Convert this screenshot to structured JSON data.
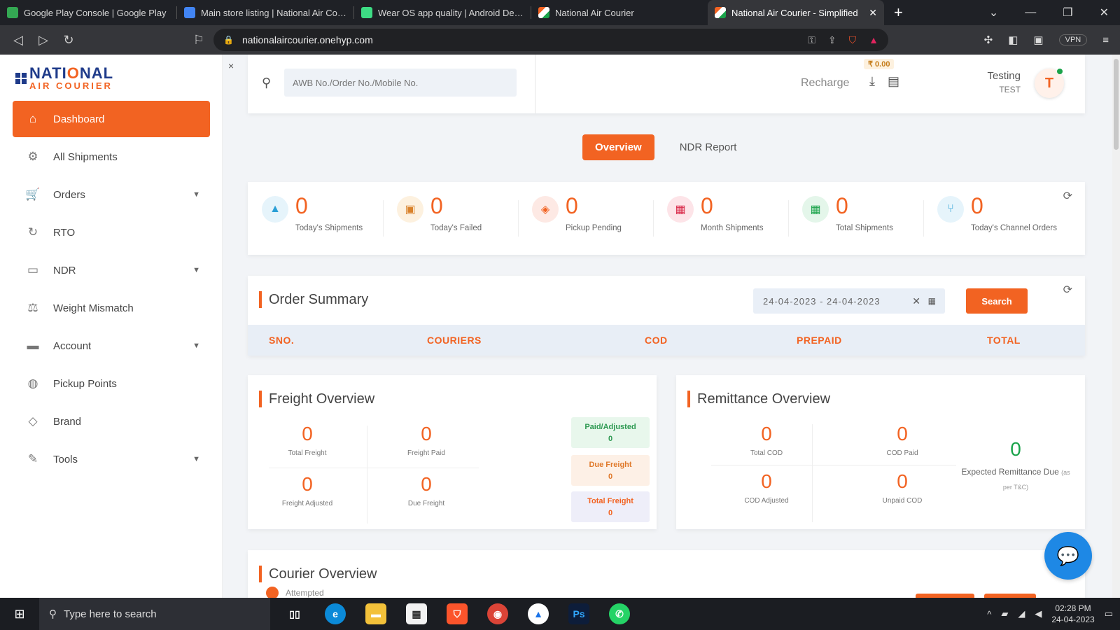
{
  "browser": {
    "tabs": [
      {
        "title": "Google Play Console | Google Play",
        "color": "#34a853"
      },
      {
        "title": "Main store listing | National Air Courier",
        "color": "#4285f4"
      },
      {
        "title": "Wear OS app quality | Android Developers",
        "color": "#3ddc84"
      },
      {
        "title": "National Air Courier",
        "color": "#f26322"
      },
      {
        "title": "National Air Courier - Simplified",
        "color": "#f26322"
      }
    ],
    "url": "nationalaircourier.onehyp.com",
    "vpn_label": "VPN"
  },
  "sidebar": {
    "logo_line1_a": "NATI",
    "logo_line1_b": "O",
    "logo_line1_c": "NAL",
    "logo_line2": "AIR COURIER",
    "close": "×",
    "items": [
      {
        "label": "Dashboard",
        "icon": "home-icon",
        "glyph": "⌂",
        "active": true,
        "chevron": false
      },
      {
        "label": "All Shipments",
        "icon": "shipments-icon",
        "glyph": "⚙",
        "active": false,
        "chevron": false
      },
      {
        "label": "Orders",
        "icon": "cart-icon",
        "glyph": "🛒",
        "active": false,
        "chevron": true
      },
      {
        "label": "RTO",
        "icon": "return-icon",
        "glyph": "↻",
        "active": false,
        "chevron": false
      },
      {
        "label": "NDR",
        "icon": "message-icon",
        "glyph": "▭",
        "active": false,
        "chevron": true
      },
      {
        "label": "Weight Mismatch",
        "icon": "weight-icon",
        "glyph": "⚖",
        "active": false,
        "chevron": false
      },
      {
        "label": "Account",
        "icon": "wallet-icon",
        "glyph": "▬",
        "active": false,
        "chevron": true
      },
      {
        "label": "Pickup Points",
        "icon": "globe-icon",
        "glyph": "◍",
        "active": false,
        "chevron": false
      },
      {
        "label": "Brand",
        "icon": "tag-icon",
        "glyph": "◇",
        "active": false,
        "chevron": false
      },
      {
        "label": "Tools",
        "icon": "wrench-icon",
        "glyph": "✎",
        "active": false,
        "chevron": true
      }
    ]
  },
  "header": {
    "search_placeholder": "AWB No./Order No./Mobile No.",
    "balance": "₹ 0.00",
    "recharge": "Recharge",
    "user_name": "Testing",
    "user_role": "TEST",
    "avatar_letter": "T"
  },
  "page_tabs": [
    "Overview",
    "NDR Report"
  ],
  "stats": [
    {
      "value": "0",
      "label": "Today's Shipments",
      "icon": "truck-icon",
      "glyph": "▲",
      "bg": "#e6f4fb",
      "fg": "#2a9fd6"
    },
    {
      "value": "0",
      "label": "Today's Failed",
      "icon": "failed-icon",
      "glyph": "▣",
      "bg": "#fdf1df",
      "fg": "#d9822b"
    },
    {
      "value": "0",
      "label": "Pickup Pending",
      "icon": "box-icon",
      "glyph": "◈",
      "bg": "#fde9e4",
      "fg": "#f26322"
    },
    {
      "value": "0",
      "label": "Month Shipments",
      "icon": "grid-icon",
      "glyph": "▦",
      "bg": "#fde4e8",
      "fg": "#d92b4a"
    },
    {
      "value": "0",
      "label": "Total Shipments",
      "icon": "table-icon",
      "glyph": "▦",
      "bg": "#e4f6ea",
      "fg": "#1aa34a"
    },
    {
      "value": "0",
      "label": "Today's Channel Orders",
      "icon": "channel-icon",
      "glyph": "⑂",
      "bg": "#e6f4fb",
      "fg": "#2a9fd6"
    }
  ],
  "order_summary": {
    "title": "Order Summary",
    "date_range": "24-04-2023 - 24-04-2023",
    "search_label": "Search",
    "columns": [
      "SNO.",
      "COURIERS",
      "COD",
      "PREPAID",
      "TOTAL"
    ]
  },
  "freight": {
    "title": "Freight Overview",
    "metrics": [
      {
        "value": "0",
        "label": "Total Freight"
      },
      {
        "value": "0",
        "label": "Freight Paid"
      },
      {
        "value": "0",
        "label": "Freight Adjusted"
      },
      {
        "value": "0",
        "label": "Due Freight"
      }
    ],
    "pills": [
      {
        "label": "Paid/Adjusted",
        "value": "0"
      },
      {
        "label": "Due Freight",
        "value": "0"
      },
      {
        "label": "Total Freight",
        "value": "0"
      }
    ]
  },
  "remittance": {
    "title": "Remittance Overview",
    "metrics": [
      {
        "value": "0",
        "label": "Total COD"
      },
      {
        "value": "0",
        "label": "COD Paid"
      },
      {
        "value": "0",
        "label": "COD Adjusted"
      },
      {
        "value": "0",
        "label": "Unpaid COD"
      }
    ],
    "expected_value": "0",
    "expected_label": "Expected Remittance Due",
    "expected_note": "(as per T&C)"
  },
  "courier": {
    "title": "Courier Overview",
    "legend": "Attempted"
  },
  "taskbar": {
    "search_placeholder": "Type here to search",
    "time": "02:28 PM",
    "date": "24-04-2023"
  },
  "colors": {
    "accent": "#f26322",
    "brand_blue": "#1f3b8a",
    "success": "#1aa34a"
  }
}
